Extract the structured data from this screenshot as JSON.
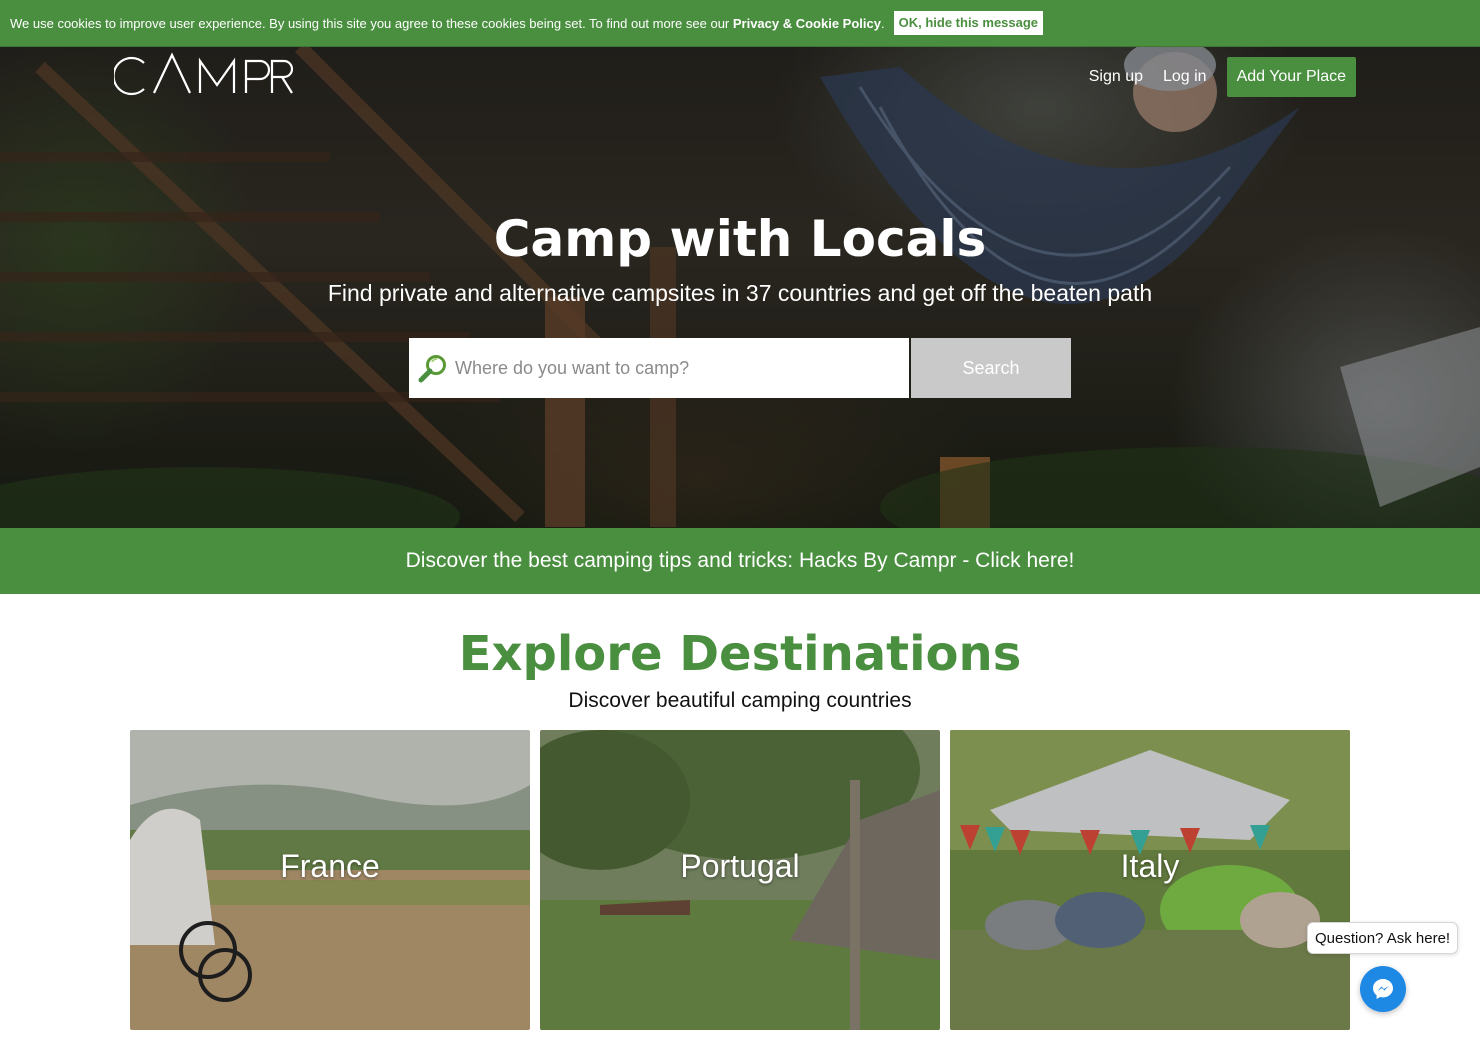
{
  "cookie_bar": {
    "text": "We use cookies to improve user experience. By using this site you agree to these cookies being set. To find out more see our ",
    "policy_link": "Privacy & Cookie Policy",
    "period": ".",
    "ok_label": "OK, hide this message"
  },
  "header": {
    "logo_text": "CAMPR",
    "signup_label": "Sign up",
    "login_label": "Log in",
    "add_place_label": "Add Your Place"
  },
  "hero": {
    "title": "Camp with Locals",
    "subtitle": "Find private and alternative campsites in 37 countries and get off the beaten path",
    "search_placeholder": "Where do you want to camp?",
    "search_button": "Search"
  },
  "tips_banner": {
    "text": "Discover the best camping tips and tricks: Hacks By Campr - Click here!"
  },
  "explore": {
    "title": "Explore Destinations",
    "subtitle": "Discover beautiful camping countries",
    "destinations": [
      {
        "name": "France"
      },
      {
        "name": "Portugal"
      },
      {
        "name": "Italy"
      }
    ]
  },
  "chat": {
    "prompt": "Question? Ask here!",
    "icon": "messenger-icon"
  },
  "colors": {
    "brand_green": "#4a8f3f",
    "search_button": "#c9c9c9",
    "messenger_blue": "#1e88e5"
  }
}
